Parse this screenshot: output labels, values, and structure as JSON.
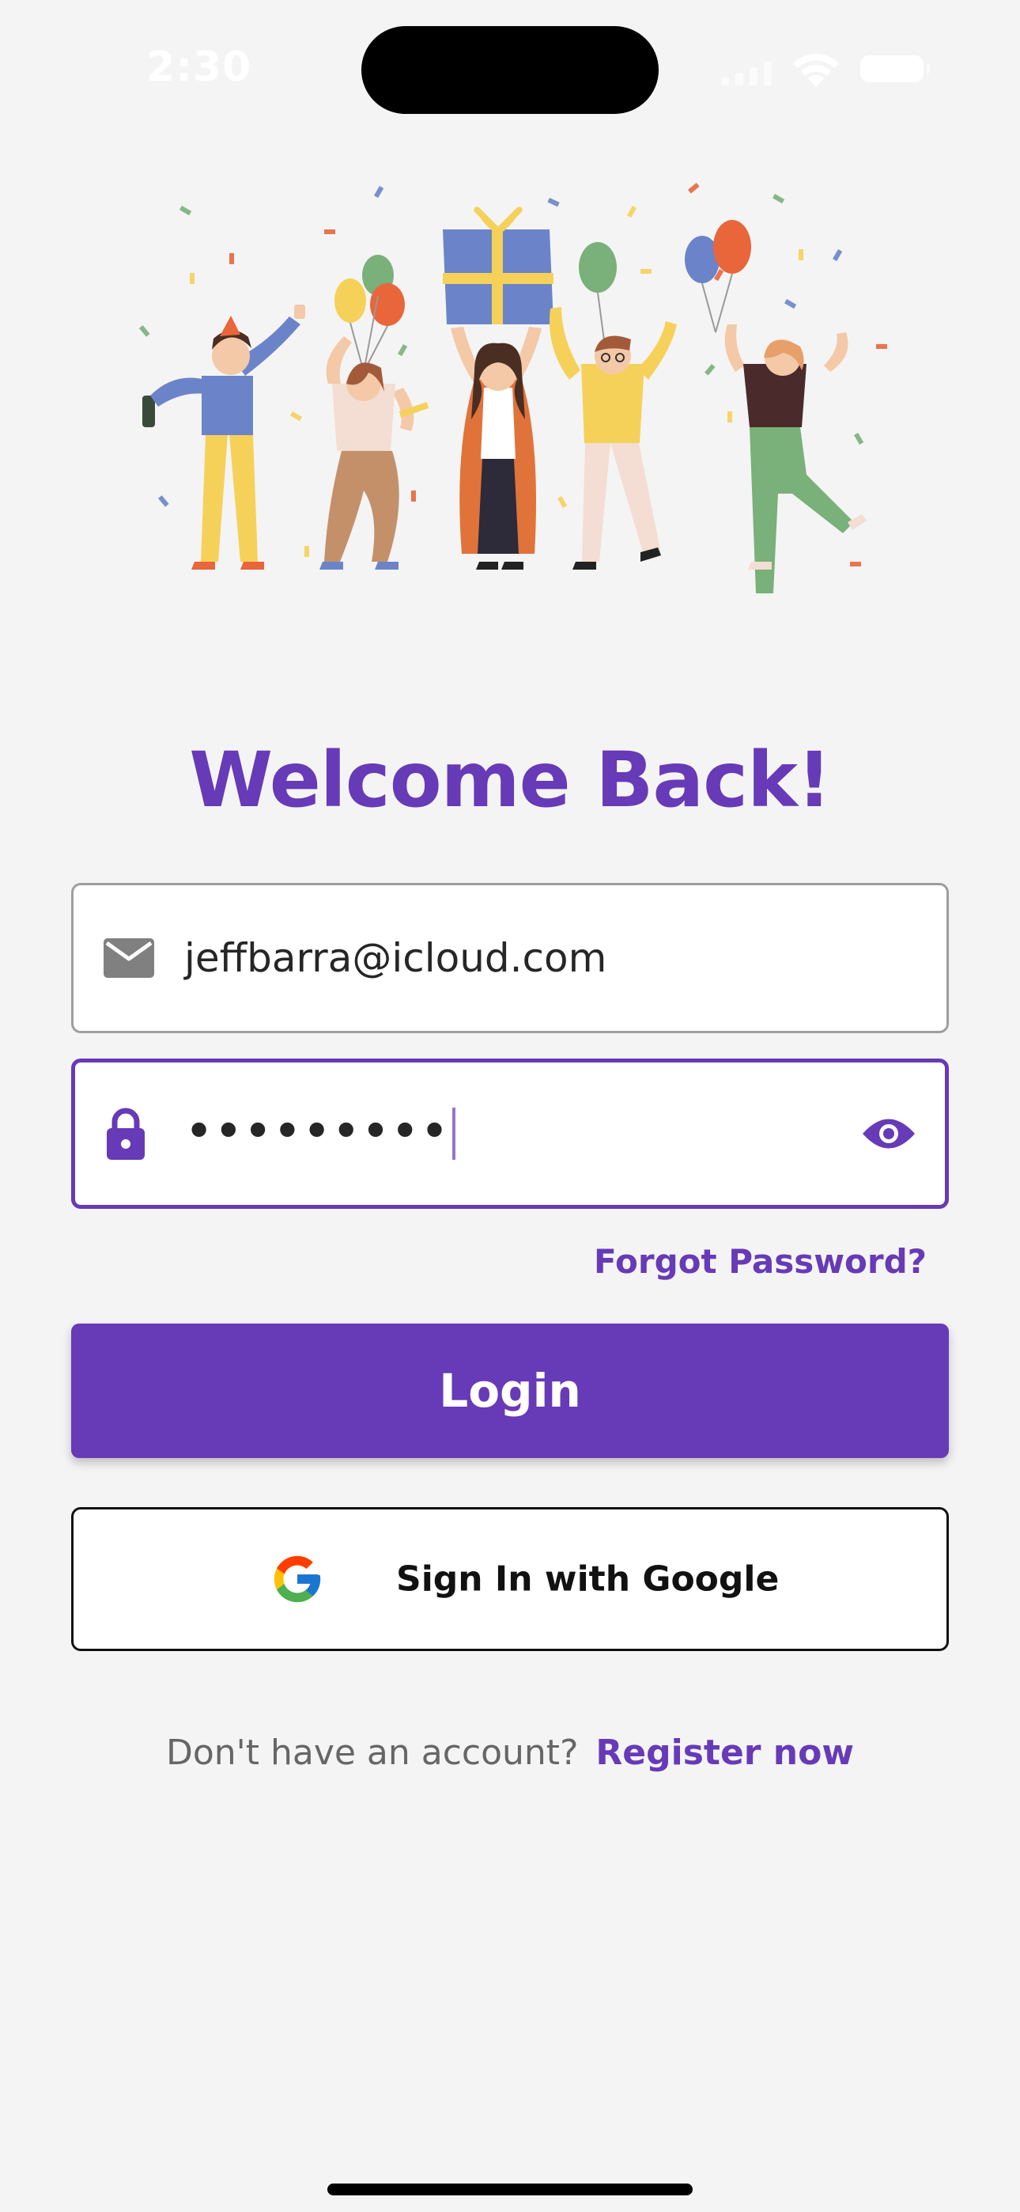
{
  "status_bar": {
    "time": "2:30"
  },
  "illustration": {
    "icon": "celebration-party-illustration"
  },
  "title": "Welcome Back!",
  "email_field": {
    "icon": "mail-icon",
    "value": "jeffbarra@icloud.com"
  },
  "password_field": {
    "icon": "lock-icon",
    "value": "•••••••••",
    "toggle_icon": "eye-icon"
  },
  "forgot_password": "Forgot Password?",
  "login_button": "Login",
  "google_button": {
    "label": "Sign In with Google",
    "icon": "google-logo"
  },
  "register": {
    "prompt": "Don't have an account?",
    "link": "Register now"
  },
  "colors": {
    "accent": "#673ab7",
    "background": "#f4f4f4"
  }
}
